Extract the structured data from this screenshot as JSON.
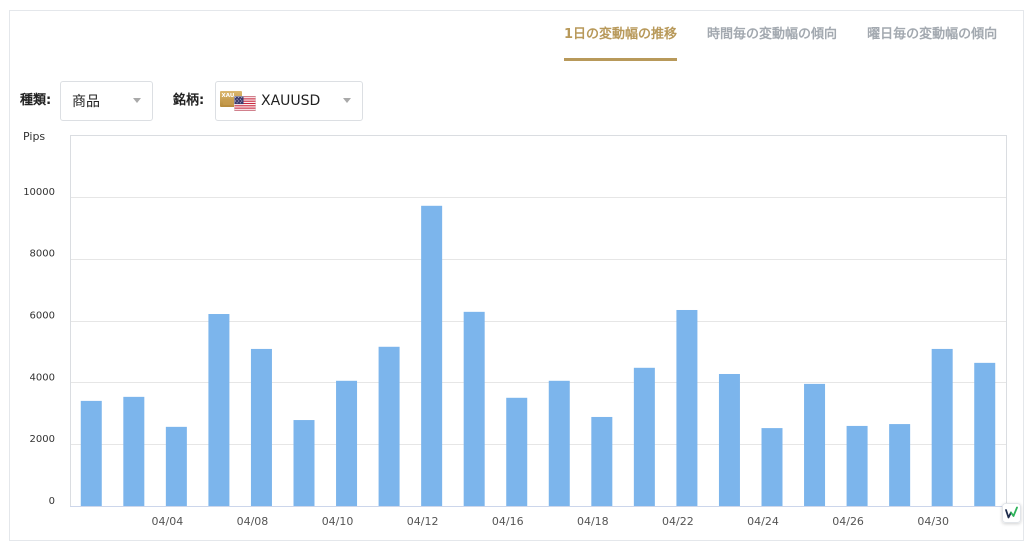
{
  "tabs": [
    {
      "label": "1日の変動幅の推移",
      "active": true
    },
    {
      "label": "時間毎の変動幅の傾向",
      "active": false
    },
    {
      "label": "曜日毎の変動幅の傾向",
      "active": false
    }
  ],
  "filters": {
    "type": {
      "label": "種類:",
      "value": "商品",
      "icon": "caret-down-icon"
    },
    "symbol": {
      "label": "銘柄:",
      "value": "XAUUSD",
      "badge": "XAU",
      "icons": [
        "gold-bar-icon",
        "us-flag-icon",
        "caret-down-icon"
      ]
    }
  },
  "colors": {
    "accent": "#b8995a",
    "tab_inactive": "#a3a9b0",
    "bar": "#7cb5ec",
    "grid": "#e6e6e6"
  },
  "chart_data": {
    "type": "bar",
    "ylabel": "Pips",
    "categories": [
      "",
      "",
      "04/04",
      "",
      "04/08",
      "",
      "04/10",
      "",
      "04/12",
      "",
      "04/16",
      "",
      "04/18",
      "",
      "04/22",
      "",
      "04/24",
      "",
      "04/26",
      "",
      "04/30",
      ""
    ],
    "values": [
      3400,
      3530,
      2560,
      6210,
      5080,
      2780,
      4050,
      5150,
      9710,
      6280,
      3500,
      4050,
      2880,
      4470,
      6340,
      4270,
      2520,
      3950,
      2590,
      2650,
      5080,
      4630
    ],
    "ylim": [
      0,
      12000
    ],
    "yticks": [
      0,
      2000,
      4000,
      6000,
      8000,
      10000
    ],
    "grid": true
  },
  "logo": {
    "icon": "site-logo-icon"
  }
}
